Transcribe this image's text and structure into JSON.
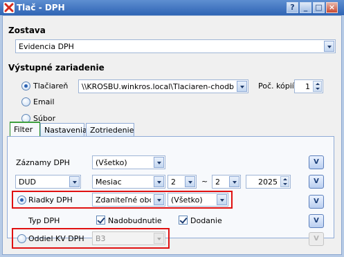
{
  "window": {
    "title": "Tlač - DPH",
    "controls": {
      "help": "?",
      "minimize": "_",
      "maximize": "□",
      "close": "×"
    }
  },
  "zostava": {
    "heading": "Zostava",
    "selected": "Evidencia DPH"
  },
  "output": {
    "heading": "Výstupné zariadenie",
    "options": {
      "printer": "Tlačiareň",
      "email": "Email",
      "file": "Súbor"
    },
    "selected_option": "printer",
    "printer_value": "\\\\KROSBU.winkros.local\\Tlaciaren-chodba-farebn",
    "copies_label": "Poč. kópií",
    "copies_value": "1"
  },
  "tabs": [
    {
      "label": "Filter",
      "active": true
    },
    {
      "label": "Nastavenia",
      "active": false
    },
    {
      "label": "Zotriedenie",
      "active": false
    }
  ],
  "filter": {
    "zaznamy": {
      "label": "Záznamy DPH",
      "value": "(Všetko)"
    },
    "period": {
      "type": "DUD",
      "unit": "Mesiac",
      "from": "2",
      "separator": "~",
      "to": "2",
      "year": "2025"
    },
    "riadky": {
      "label": "Riadky DPH",
      "selected": true,
      "value1": "Zdaniteľné obchody",
      "value2": "(Všetko)"
    },
    "typ": {
      "label": "Typ DPH",
      "check1": "Nadobudnutie",
      "check2": "Dodanie"
    },
    "oddiel": {
      "label": "Oddiel KV DPH",
      "selected": false,
      "value": "B3"
    },
    "v_button": "V"
  },
  "colors": {
    "titlebar": "#2f64b4",
    "highlight_box": "#e01010",
    "active_tab_accent": "#3da03d"
  }
}
